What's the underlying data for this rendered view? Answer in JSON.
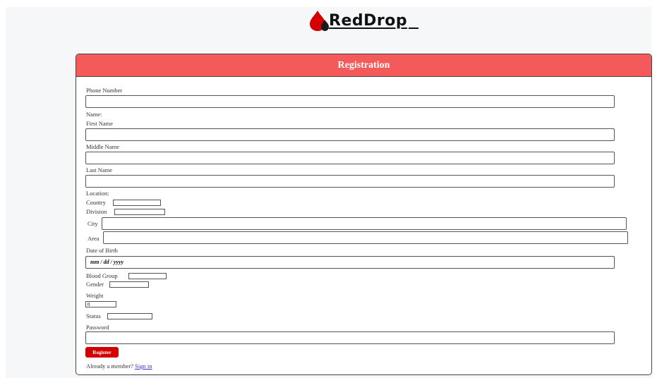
{
  "brand": {
    "name": "RedDrop",
    "accent": "#d40000",
    "header_color": "#f55a5a"
  },
  "form": {
    "title": "Registration",
    "phone_label": "Phone Number",
    "name_section": "Name:",
    "first_name_label": "First Name",
    "middle_name_label": "Middle Name",
    "last_name_label": "Last Name",
    "location_section": "Location:",
    "country_label": "Country",
    "division_label": "Division",
    "city_label": "City",
    "area_label": "Area",
    "dob_label": "Date of Birth",
    "dob_placeholder": "mm / dd / yyyy",
    "blood_group_label": "Blood Group",
    "gender_label": "Gender",
    "weight_label": "Weight",
    "weight_value": "0",
    "status_label": "Status",
    "password_label": "Password",
    "register_button": "Register",
    "member_text": "Already a member?",
    "signin_link": "Sign in"
  }
}
